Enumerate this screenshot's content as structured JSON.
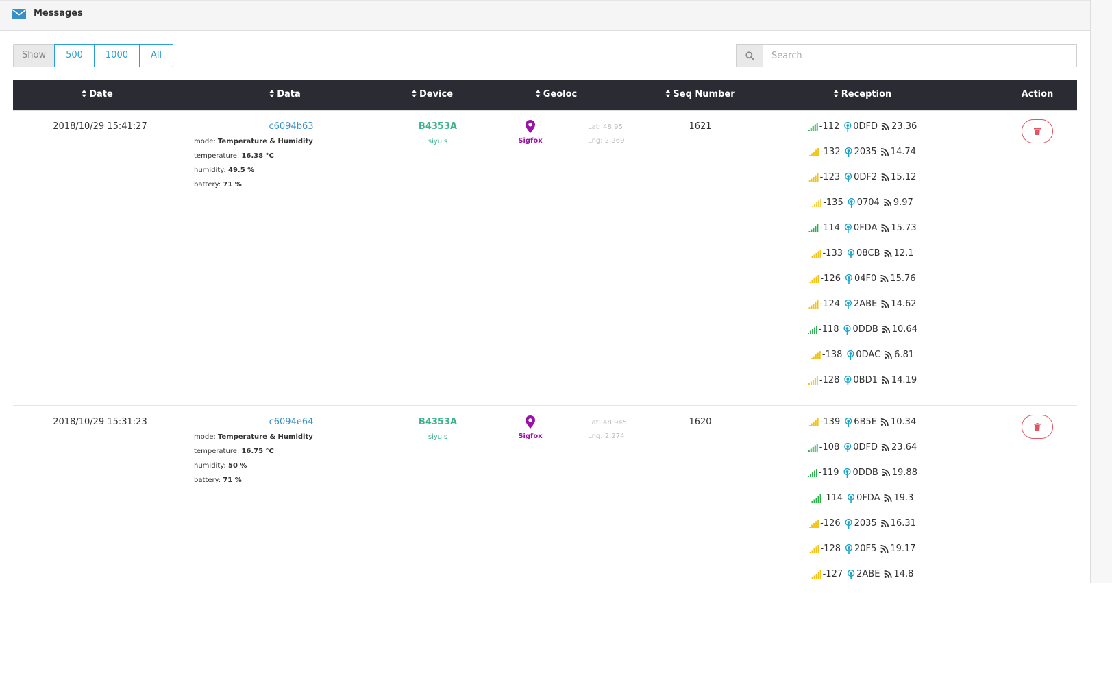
{
  "panel": {
    "title": "Messages"
  },
  "toolbar": {
    "show_label": "Show",
    "show_options": [
      "500",
      "1000",
      "All"
    ],
    "search_placeholder": "Search"
  },
  "table": {
    "columns": [
      "Date",
      "Data",
      "Device",
      "Geoloc",
      "Seq Number",
      "Reception",
      "Action"
    ]
  },
  "colors": {
    "header_bg": "#2a2b33",
    "link_blue": "#3a8fc7",
    "device_green": "#3fb489",
    "sigfox_purple": "#9a10a8",
    "signal_good": "#2bb04a",
    "signal_weak": "#f0c419",
    "antenna_cyan": "#1aa3c9",
    "delete_red": "#e05565"
  },
  "rows": [
    {
      "date": "2018/10/29 15:41:27",
      "data_id": "c6094b63",
      "fields": [
        {
          "label": "mode: ",
          "value": "Temperature & Humidity"
        },
        {
          "label": "temperature: ",
          "value": "16.38 °C"
        },
        {
          "label": "humidity: ",
          "value": "49.5 %"
        },
        {
          "label": "battery: ",
          "value": "71 %"
        }
      ],
      "device_id": "B4353A",
      "device_name": "siyu's",
      "geoloc_source": "Sigfox",
      "lat": "Lat: 48.95",
      "lng": "Lng: 2.269",
      "seq": "1621",
      "reception": [
        {
          "rssi": "-112",
          "station": "0DFD",
          "snr": "23.36",
          "quality": "good"
        },
        {
          "rssi": "-132",
          "station": "2035",
          "snr": "14.74",
          "quality": "weak"
        },
        {
          "rssi": "-123",
          "station": "0DF2",
          "snr": "15.12",
          "quality": "weak"
        },
        {
          "rssi": "-135",
          "station": "0704",
          "snr": "9.97",
          "quality": "weak"
        },
        {
          "rssi": "-114",
          "station": "0FDA",
          "snr": "15.73",
          "quality": "good"
        },
        {
          "rssi": "-133",
          "station": "08CB",
          "snr": "12.1",
          "quality": "weak"
        },
        {
          "rssi": "-126",
          "station": "04F0",
          "snr": "15.76",
          "quality": "weak"
        },
        {
          "rssi": "-124",
          "station": "2ABE",
          "snr": "14.62",
          "quality": "weak"
        },
        {
          "rssi": "-118",
          "station": "0DDB",
          "snr": "10.64",
          "quality": "good"
        },
        {
          "rssi": "-138",
          "station": "0DAC",
          "snr": "6.81",
          "quality": "weak"
        },
        {
          "rssi": "-128",
          "station": "0BD1",
          "snr": "14.19",
          "quality": "weak"
        }
      ]
    },
    {
      "date": "2018/10/29 15:31:23",
      "data_id": "c6094e64",
      "fields": [
        {
          "label": "mode: ",
          "value": "Temperature & Humidity"
        },
        {
          "label": "temperature: ",
          "value": "16.75 °C"
        },
        {
          "label": "humidity: ",
          "value": "50 %"
        },
        {
          "label": "battery: ",
          "value": "71 %"
        }
      ],
      "device_id": "B4353A",
      "device_name": "siyu's",
      "geoloc_source": "Sigfox",
      "lat": "Lat: 48.945",
      "lng": "Lng: 2.274",
      "seq": "1620",
      "reception": [
        {
          "rssi": "-139",
          "station": "6B5E",
          "snr": "10.34",
          "quality": "weak"
        },
        {
          "rssi": "-108",
          "station": "0DFD",
          "snr": "23.64",
          "quality": "good"
        },
        {
          "rssi": "-119",
          "station": "0DDB",
          "snr": "19.88",
          "quality": "good"
        },
        {
          "rssi": "-114",
          "station": "0FDA",
          "snr": "19.3",
          "quality": "good"
        },
        {
          "rssi": "-126",
          "station": "2035",
          "snr": "16.31",
          "quality": "weak"
        },
        {
          "rssi": "-128",
          "station": "20F5",
          "snr": "19.17",
          "quality": "weak"
        },
        {
          "rssi": "-127",
          "station": "2ABE",
          "snr": "14.8",
          "quality": "weak"
        }
      ]
    }
  ]
}
